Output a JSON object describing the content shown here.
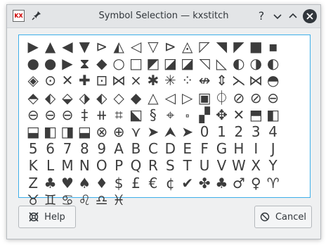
{
  "window": {
    "title": "Symbol Selection — kxstitch",
    "app_icon_text": "KX",
    "help_glyph": "?"
  },
  "symbols": [
    "▶",
    "▲",
    "◀",
    "▼",
    "⊳",
    "◭",
    "◁",
    "▽",
    "⊳",
    "◬",
    "◸",
    "◥",
    "◤",
    "■",
    "▪",
    "●",
    "●",
    "▶",
    "⧗",
    "◆",
    "○",
    "□",
    "◩",
    "◪",
    "◪",
    "◹",
    "◺",
    "◐",
    "◑",
    "◐",
    "◈",
    "⊙",
    "✕",
    "✚",
    "⊡",
    "⋈",
    "⨯",
    "✱",
    "✳",
    "⁘",
    "↮",
    "⇕",
    "⋋",
    "⋈",
    "◓",
    "⬘",
    "⬖",
    "⬙",
    "⬗",
    "⬖",
    "◇",
    "◆",
    "△",
    "◁",
    "▷",
    "▣",
    "⏀",
    "⊘",
    "⊘",
    "⊖",
    "⊖",
    "⊖",
    "⊖",
    "‡",
    "⧺",
    "⌗",
    "⬕",
    "§",
    "⌖",
    "⬞",
    "▞",
    "✥",
    "✕",
    "⬒",
    "◧",
    "⬓",
    "◧",
    "◨",
    "⬓",
    "⊗",
    "⊕",
    "⋎",
    "➤",
    "⮝",
    "➤",
    "0",
    "1",
    "2",
    "3",
    "4",
    "5",
    "6",
    "7",
    "8",
    "9",
    "A",
    "B",
    "C",
    "D",
    "E",
    "F",
    "G",
    "H",
    "I",
    "J",
    "K",
    "L",
    "M",
    "N",
    "O",
    "P",
    "Q",
    "R",
    "S",
    "T",
    "U",
    "V",
    "W",
    "X",
    "Y",
    "Z",
    "♣",
    "♥",
    "♠",
    "♦",
    "$",
    "£",
    "€",
    "¢",
    "✔",
    "✤",
    "♣",
    "♂",
    "♀",
    "♈",
    "♉",
    "♊",
    "♋",
    "♌",
    "♎",
    "♓"
  ],
  "buttons": {
    "help": "Help",
    "cancel": "Cancel"
  },
  "colors": {
    "accent": "#3daee9",
    "symbol": "#3c3c3c"
  }
}
